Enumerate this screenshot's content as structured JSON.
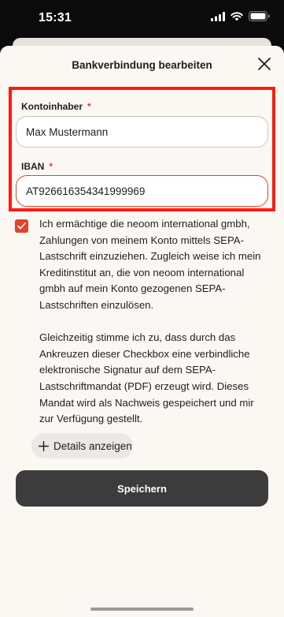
{
  "status_bar": {
    "time": "15:31"
  },
  "sheet": {
    "title": "Bankverbindung bearbeiten"
  },
  "form": {
    "account_holder": {
      "label": "Kontoinhaber",
      "required_mark": "*",
      "value": "Max Mustermann"
    },
    "iban": {
      "label": "IBAN",
      "required_mark": "*",
      "value": "AT926616354341999969"
    }
  },
  "consent": {
    "checked": true,
    "paragraph_1": "Ich ermächtige die neoom international gmbh, Zahlungen von meinem Konto mittels SEPA-Lastschrift einzuziehen. Zugleich weise ich mein Kreditinstitut an, die von neoom international gmbh auf mein Konto gezogenen SEPA-Lastschriften einzulösen.",
    "paragraph_2": "Gleichzeitig stimme ich zu, dass durch das Ankreuzen dieser Checkbox eine verbindliche elektronische Signatur auf dem SEPA-Lastschriftmandat (PDF) erzeugt wird. Dieses Mandat wird als Nachweis gespeichert und mir zur Verfügung gestellt."
  },
  "details_button": {
    "label": "Details anzeigen",
    "icon": "plus-icon"
  },
  "save_button": {
    "label": "Speichern"
  },
  "colors": {
    "accent": "#e0442a",
    "highlight": "#ff1a0e",
    "primary_button": "#3c3c3c",
    "sheet_background": "#fbf8f4"
  }
}
